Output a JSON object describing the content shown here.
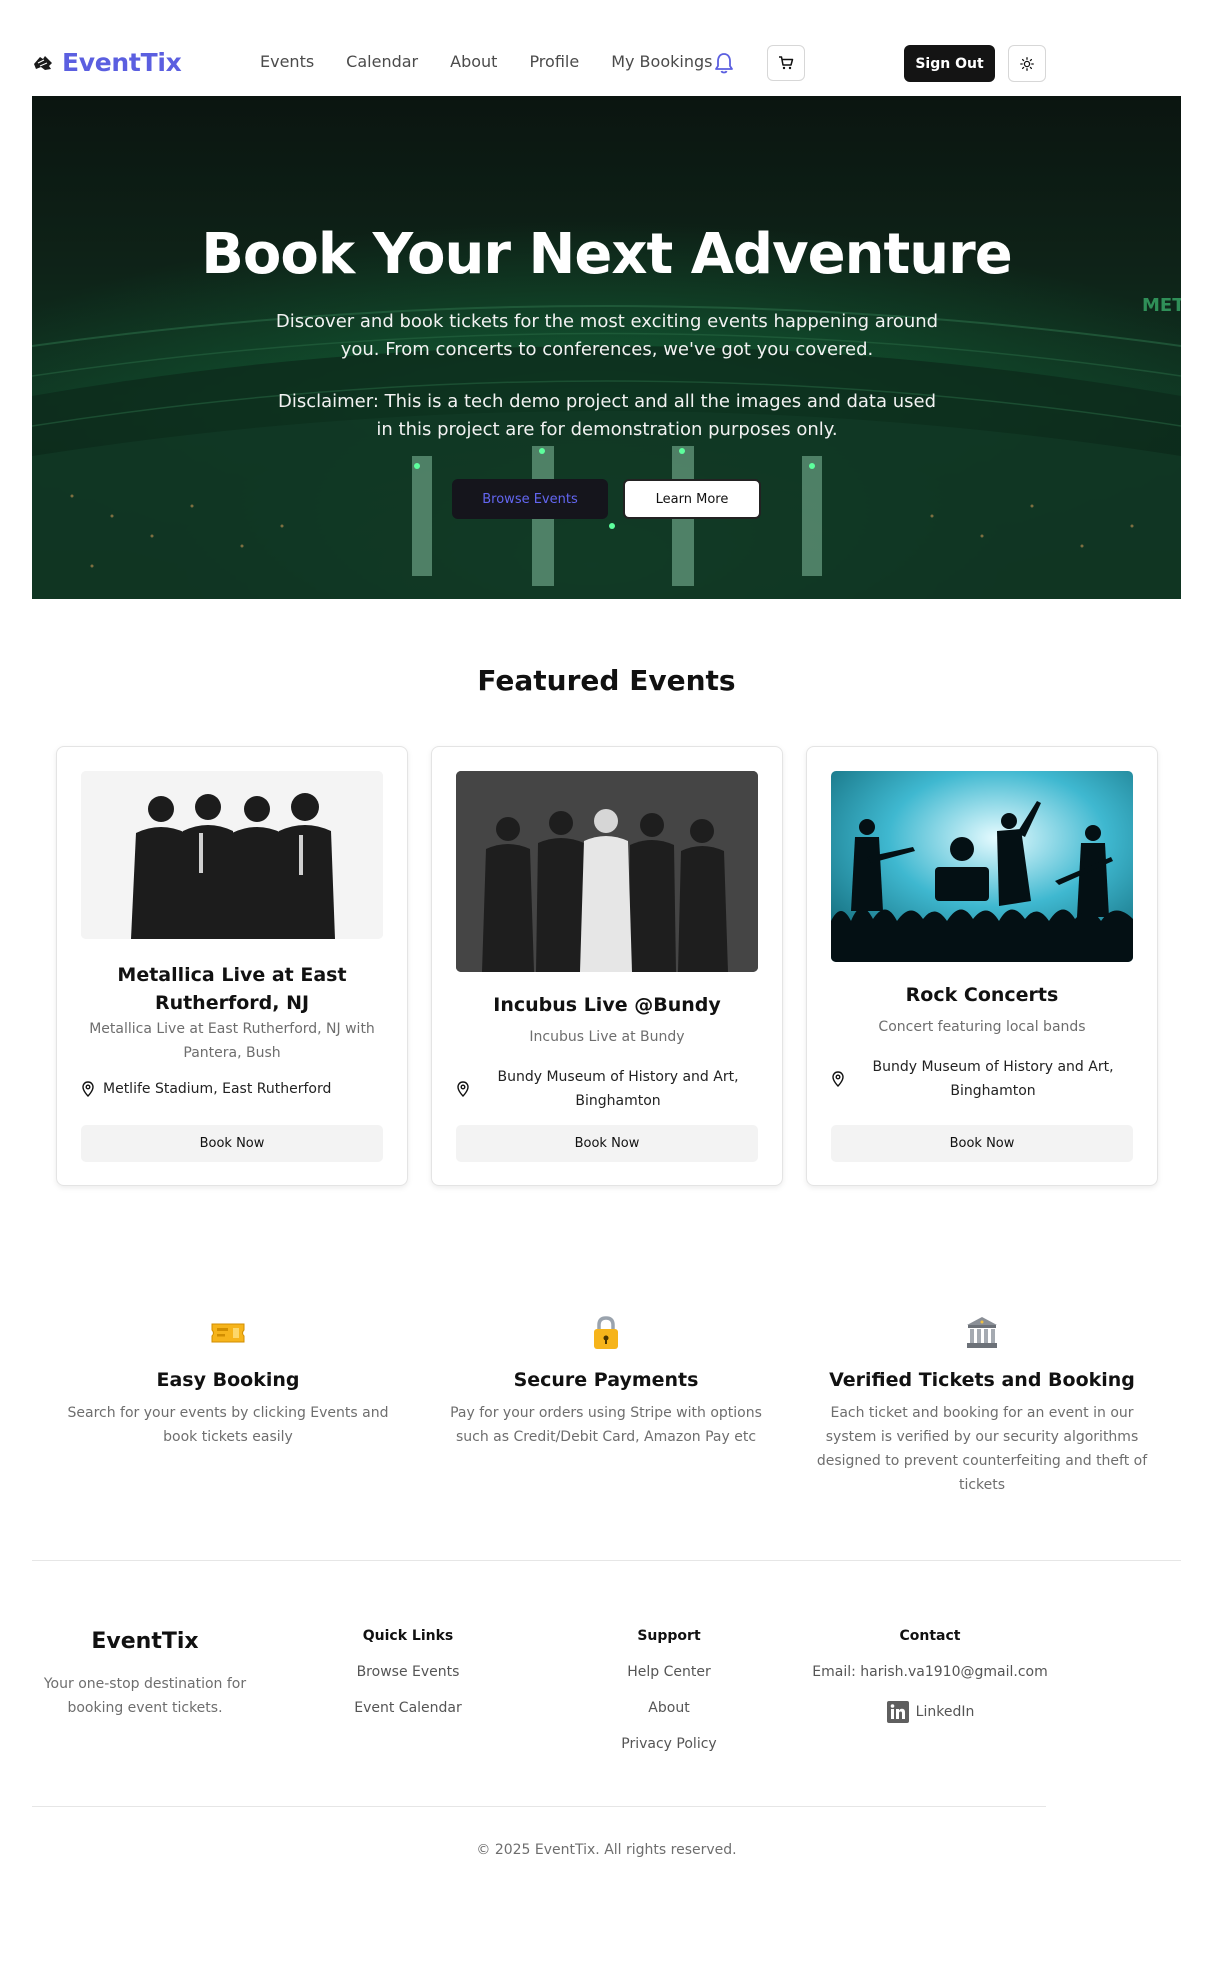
{
  "nav": {
    "brand": "EventTix",
    "brand_icon": "ticket-icon",
    "links": [
      "Events",
      "Calendar",
      "About",
      "Profile",
      "My Bookings"
    ],
    "bell_icon": "bell-icon",
    "cart_icon": "cart-icon",
    "signout_label": "Sign Out",
    "theme_icon": "sun-icon",
    "accent_color": "#5b5fe0"
  },
  "hero": {
    "title": "Book Your Next Adventure",
    "subtitle": "Discover and book tickets for the most exciting events happening around you. From concerts to conferences, we've got you covered.",
    "disclaimer": "Disclaimer: This is a tech demo project and all the images and data used in this project are for demonstration purposes only.",
    "browse_label": "Browse Events",
    "learn_label": "Learn More",
    "background": "stadium-concert-photo"
  },
  "featured": {
    "title": "Featured Events",
    "events": [
      {
        "title": "Metallica Live at East Rutherford, NJ",
        "description": "Metallica Live at East Rutherford, NJ with Pantera, Bush",
        "location": "Metlife Stadium, East Rutherford",
        "button": "Book Now",
        "image": "band-photo"
      },
      {
        "title": "Incubus Live @Bundy",
        "description": "Incubus Live at Bundy",
        "location": "Bundy Museum of History and Art, Binghamton",
        "button": "Book Now",
        "image": "band-photo"
      },
      {
        "title": "Rock Concerts",
        "description": "Concert featuring local bands",
        "location": "Bundy Museum of History and Art, Binghamton",
        "button": "Book Now",
        "image": "concert-silhouette"
      }
    ]
  },
  "features": [
    {
      "icon": "ticket-icon",
      "title": "Easy Booking",
      "description": "Search for your events by clicking Events and book tickets easily"
    },
    {
      "icon": "lock-icon",
      "title": "Secure Payments",
      "description": "Pay for your orders using Stripe with options such as Credit/Debit Card, Amazon Pay etc"
    },
    {
      "icon": "bank-icon",
      "title": "Verified Tickets and Booking",
      "description": "Each ticket and booking for an event in our system is verified by our security algorithms designed to prevent counterfeiting and theft of tickets"
    }
  ],
  "footer": {
    "brand": "EventTix",
    "tagline": "Your one-stop destination for booking event tickets.",
    "quick_links": {
      "title": "Quick Links",
      "items": [
        "Browse Events",
        "Event Calendar"
      ]
    },
    "support": {
      "title": "Support",
      "items": [
        "Help Center",
        "About",
        "Privacy Policy"
      ]
    },
    "contact": {
      "title": "Contact",
      "email": "Email: harish.va1910@gmail.com",
      "linkedin": "LinkedIn"
    },
    "copyright": "© 2025 EventTix. All rights reserved."
  }
}
